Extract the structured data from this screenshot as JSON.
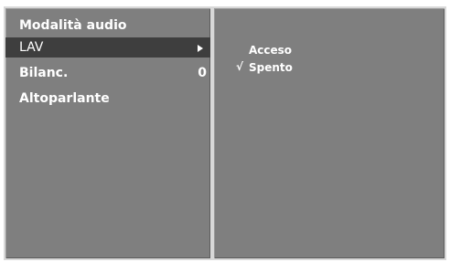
{
  "menu": {
    "items": [
      {
        "label": "Modalità audio",
        "value": ""
      },
      {
        "label": "LAV",
        "value": ""
      },
      {
        "label": "Bilanc.",
        "value": "0"
      },
      {
        "label": "Altoparlante",
        "value": ""
      }
    ],
    "selected_index": 1
  },
  "submenu": {
    "options": [
      {
        "label": "Acceso",
        "checked": false
      },
      {
        "label": "Spento",
        "checked": true
      }
    ],
    "check_symbol": "√"
  }
}
